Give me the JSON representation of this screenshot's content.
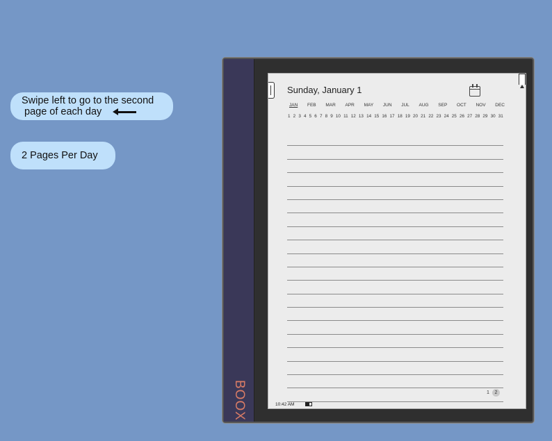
{
  "tips": {
    "swipe_line1": "Swipe left to go to the second",
    "swipe_line2": "page of each day",
    "pages_per_day": "2 Pages Per Day"
  },
  "device": {
    "brand": "BOOX"
  },
  "planner": {
    "date_title": "Sunday, January 1",
    "months": [
      "JAN",
      "FEB",
      "MAR",
      "APR",
      "MAY",
      "JUN",
      "JUL",
      "AUG",
      "SEP",
      "OCT",
      "NOV",
      "DEC"
    ],
    "active_month": "JAN",
    "days": [
      "1",
      "2",
      "3",
      "4",
      "5",
      "6",
      "7",
      "8",
      "9",
      "10",
      "11",
      "12",
      "13",
      "14",
      "15",
      "16",
      "17",
      "18",
      "19",
      "20",
      "21",
      "22",
      "23",
      "24",
      "25",
      "26",
      "27",
      "28",
      "29",
      "30",
      "31"
    ],
    "line_count": 20,
    "page_numbers": [
      "1",
      "2"
    ],
    "current_page": "2"
  },
  "status_bar": {
    "time": "10:42 AM"
  },
  "colors": {
    "background": "#7597c6",
    "bubble": "#bfe0fb",
    "spine": "#3a3858",
    "brand": "#d97c66"
  }
}
